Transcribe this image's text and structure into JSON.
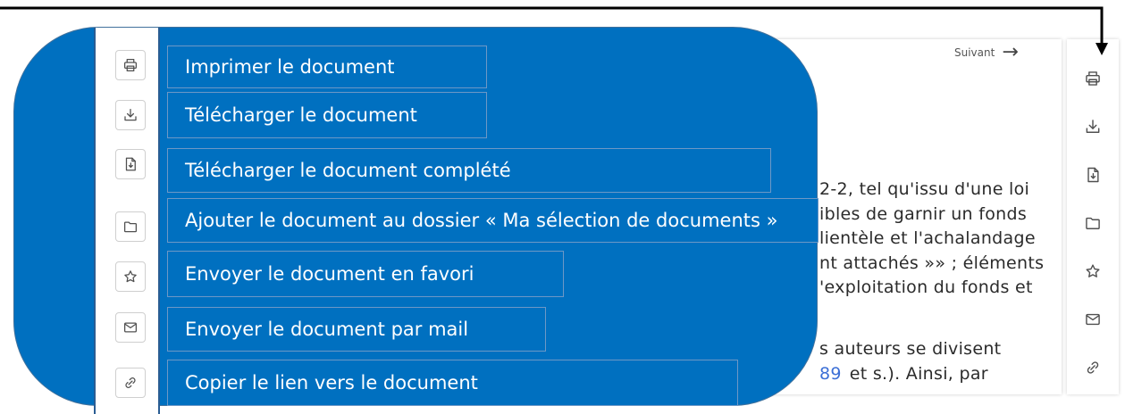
{
  "overlay": {
    "items": [
      {
        "icon": "print-icon",
        "label": "Imprimer le document"
      },
      {
        "icon": "download-icon",
        "label": "Télécharger le document"
      },
      {
        "icon": "file-download-icon",
        "label": "Télécharger le document complété"
      },
      {
        "icon": "folder-icon",
        "label": "Ajouter le document au dossier « Ma sélection de documents »"
      },
      {
        "icon": "star-icon",
        "label": "Envoyer le document en favori"
      },
      {
        "icon": "mail-icon",
        "label": "Envoyer le document par mail"
      },
      {
        "icon": "link-icon",
        "label": "Copier le lien vers le document"
      }
    ]
  },
  "page": {
    "next_link": {
      "label": "Suivant",
      "arrow": "→"
    },
    "paragraph_1": [
      "2-2, tel qu'issu d'une loi",
      "ibles de garnir un fonds",
      "lientèle et l'achalandage",
      "nt attachés »» ; éléments",
      "'exploitation du fonds et"
    ],
    "paragraph_2": {
      "line_1": "s auteurs se divisent",
      "link": "89",
      "text_after_link": "et s.). Ainsi, par"
    }
  },
  "toolbar": {
    "icons": [
      "print-icon",
      "download-icon",
      "file-download-icon",
      "folder-icon",
      "star-icon",
      "mail-icon",
      "link-icon"
    ]
  },
  "colors": {
    "overlay_blue": "#0070C0",
    "overlay_text": "#FFFFFF",
    "link_blue": "#3B6FD6",
    "callout_arrow": "#000000"
  }
}
